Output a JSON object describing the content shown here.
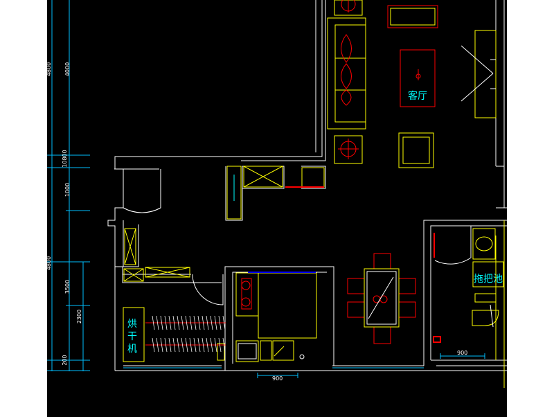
{
  "drawing": {
    "background": "#000000",
    "colors": {
      "wall": "#ffffff",
      "furniture": "#ffff00",
      "detail": "#ff0000",
      "label": "#00ffff",
      "dimension": "#00bfff",
      "blue": "#0000ff",
      "orange": "#ff8800"
    },
    "rooms": {
      "living_room": "客厅",
      "mop_sink": "拖把池",
      "dryer_1": "烘",
      "dryer_2": "干",
      "dryer_3": "机"
    },
    "dimensions": {
      "left_outer_top": "4800",
      "left_outer_bottom": "4800",
      "left_inner_1": "4000",
      "left_inner_2": "10800",
      "left_inner_3": "1000",
      "left_inner_4": "3500",
      "left_inner_5": "2300",
      "left_inner_6": "200",
      "bottom_1": "900",
      "bottom_2": "900"
    }
  }
}
